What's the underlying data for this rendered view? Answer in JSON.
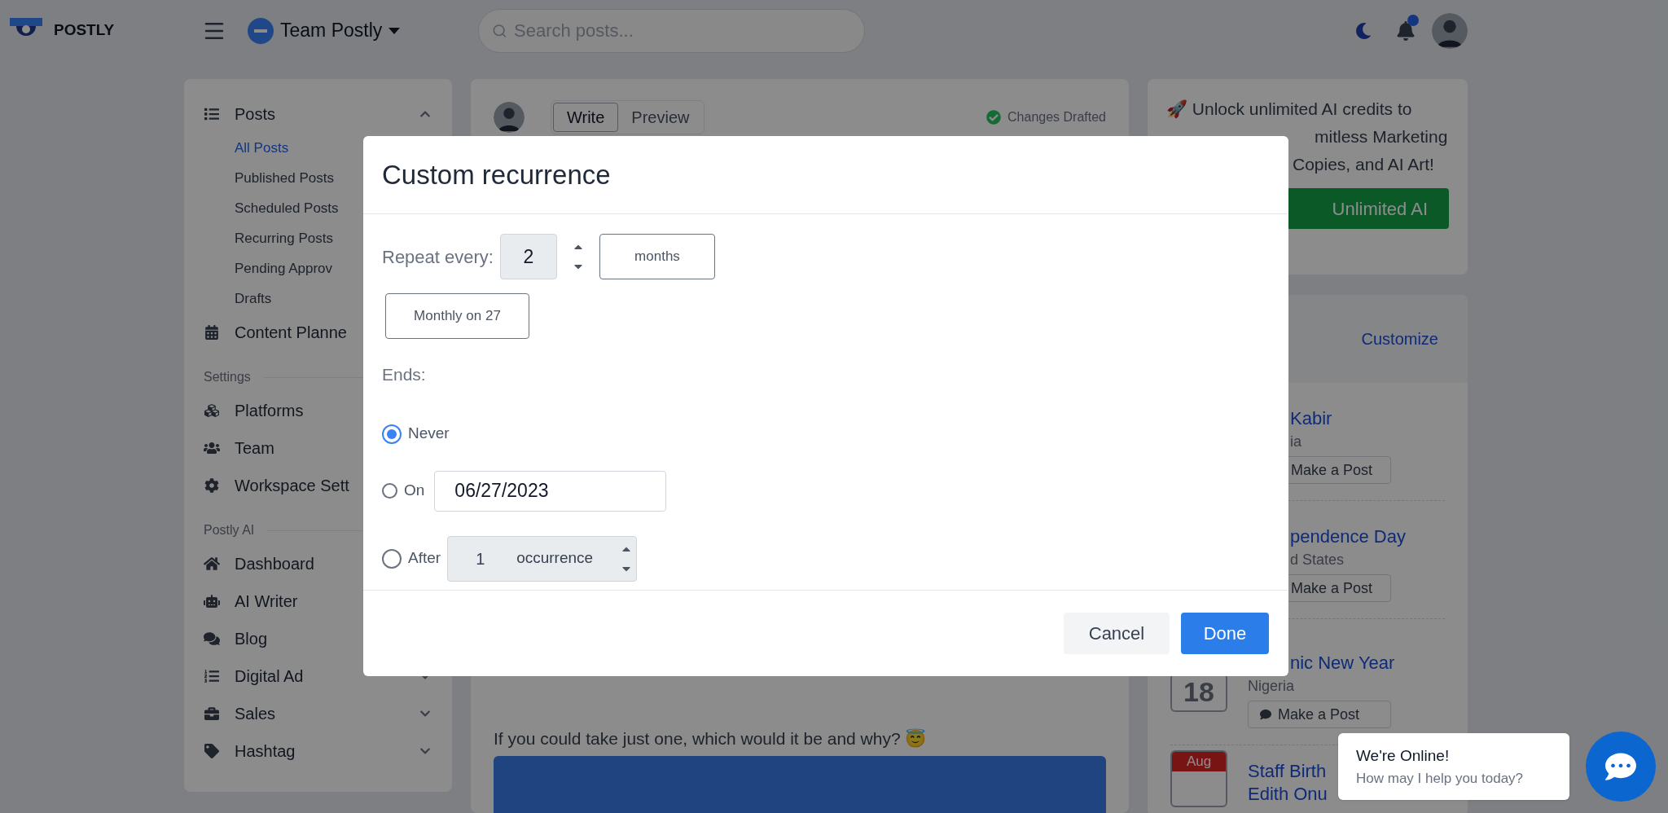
{
  "header": {
    "logo": "POSTLY",
    "team": "Team Postly",
    "search": {
      "placeholder": "Search posts..."
    },
    "notifications_badge": true
  },
  "sidebar": {
    "sections": [
      {
        "items": [
          {
            "label": "Posts",
            "expanded": true,
            "children": [
              {
                "label": "All Posts",
                "selected": true
              },
              {
                "label": "Published Posts",
                "selected": false
              },
              {
                "label": "Scheduled Posts",
                "selected": false
              },
              {
                "label": "Recurring Posts",
                "selected": false
              },
              {
                "label": "Pending Approv",
                "selected": false
              },
              {
                "label": "Drafts",
                "selected": false
              }
            ]
          },
          {
            "label": "Content Planne"
          }
        ]
      },
      {
        "heading": "Settings",
        "items": [
          {
            "label": "Platforms"
          },
          {
            "label": "Team"
          },
          {
            "label": "Workspace Sett"
          }
        ]
      },
      {
        "heading": "Postly AI",
        "items": [
          {
            "label": "Dashboard"
          },
          {
            "label": "AI Writer"
          },
          {
            "label": "Blog"
          },
          {
            "label": "Digital Ad",
            "expanded": false
          },
          {
            "label": "Sales",
            "expanded": false
          },
          {
            "label": "Hashtag",
            "expanded": false
          }
        ]
      }
    ]
  },
  "composer": {
    "tabs": [
      {
        "label": "Write",
        "selected": true
      },
      {
        "label": "Preview",
        "selected": false
      }
    ],
    "status": "Changes Drafted",
    "post_text": "If you could take just one, which would it be and why? 😇"
  },
  "promo": {
    "lines": [
      "🚀 Unlock unlimited AI credits to",
      "mitless Marketing",
      "Copies, and AI Art!"
    ],
    "button": "Unlimited AI"
  },
  "events": {
    "customize": "Customize",
    "items": [
      {
        "title": "Kabir",
        "subtitle": "ia",
        "action": "Make a Post"
      },
      {
        "title": "pendence Day",
        "subtitle": "d States",
        "action": "Make a Post"
      },
      {
        "title": "nic New Year",
        "subtitle": "Nigeria",
        "action": "Make a Post",
        "date": {
          "day": "18"
        }
      },
      {
        "title": "Staff Birth",
        "title_2": "Edith Onu",
        "date": {
          "month": "Aug"
        }
      }
    ]
  },
  "modal": {
    "title": "Custom recurrence",
    "repeat": {
      "label": "Repeat every:",
      "value": "2",
      "unit": "months"
    },
    "pattern": "Monthly on 27",
    "ends": {
      "label": "Ends:",
      "options": [
        {
          "kind": "plain",
          "label": "Never",
          "selected": true
        },
        {
          "kind": "date",
          "label": "On",
          "value": "06/27/2023",
          "selected": false
        },
        {
          "kind": "count",
          "label": "After",
          "value": "1",
          "unit": "occurrence",
          "selected": false
        }
      ]
    },
    "buttons": {
      "cancel": "Cancel",
      "done": "Done"
    }
  },
  "chat": {
    "title": "We're Online!",
    "subtitle": "How may I help you today?"
  }
}
